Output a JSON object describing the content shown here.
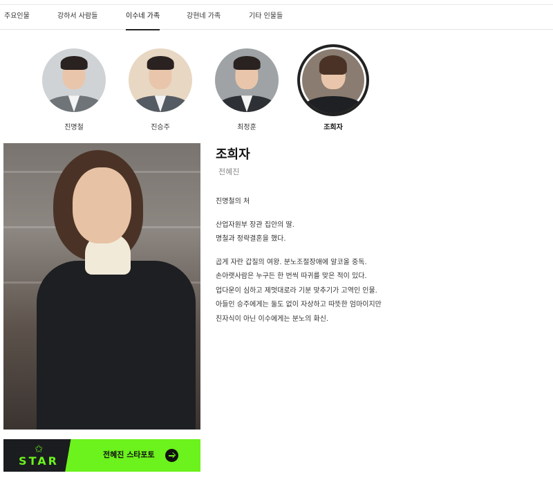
{
  "tabs": [
    {
      "label": "주요인물"
    },
    {
      "label": "강하서 사람들"
    },
    {
      "label": "이수네 가족"
    },
    {
      "label": "강현네 가족"
    },
    {
      "label": "기타 인물들"
    }
  ],
  "active_tab": "이수네 가족",
  "characters": [
    {
      "name": "진명철"
    },
    {
      "name": "진승주"
    },
    {
      "name": "최정훈"
    },
    {
      "name": "조희자"
    }
  ],
  "selected": {
    "name": "조희자",
    "actor": "전혜진",
    "description": [
      [
        "진명철의 처"
      ],
      [
        "산업자원부 장관 집안의 딸.",
        "명철과 정략결혼을 했다."
      ],
      [
        "곱게 자란 갑질의 여왕. 분노조절장애에 알코올 중독.",
        "손아랫사람은 누구든 한 번씩 따귀를 맞은 적이 있다.",
        "업다운이 심하고 제멋대로라 기분 맞추기가 고역인 인물.",
        "아들인 승주에게는 둘도 없이 자상하고 따뜻한 엄마이지만",
        "친자식이 아닌 이수에게는 분노의 화신."
      ]
    ]
  },
  "star_banner": {
    "logo": "STAR",
    "cta": "전혜진 스타포토"
  },
  "colors": {
    "accent_green": "#6cf21c",
    "banner_dark": "#1a1c1f",
    "active_border": "#222222"
  }
}
